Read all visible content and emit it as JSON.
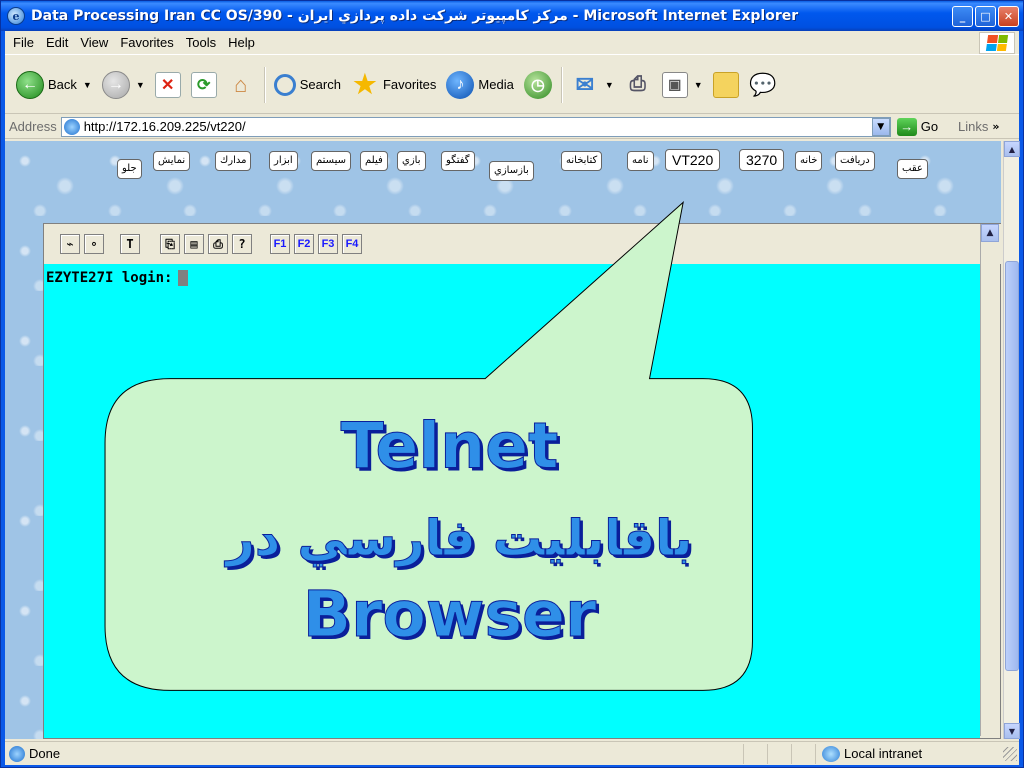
{
  "window": {
    "title": "Data Processing Iran CC OS/390 - مرکز کامپیوتر شرکت داده پردازي ايران - Microsoft Internet Explorer",
    "app_icon": "ie-icon"
  },
  "menubar": {
    "items": [
      "File",
      "Edit",
      "View",
      "Favorites",
      "Tools",
      "Help"
    ]
  },
  "toolbar": {
    "back_label": "Back",
    "search_label": "Search",
    "favorites_label": "Favorites",
    "media_label": "Media"
  },
  "address": {
    "label": "Address",
    "url": "http://172.16.209.225/vt220/",
    "go_label": "Go",
    "links_label": "Links"
  },
  "nav_buttons": {
    "back": "عقب",
    "receive": "دریافت",
    "home": "خانه",
    "b3270": "3270",
    "vt220": "VT220",
    "letter": "نامه",
    "library": "کتابخانه",
    "restore": "بازسازي",
    "chat": "گفتگو",
    "game": "بازي",
    "film": "فيلم",
    "system": "سيستم",
    "tools": "ابزار",
    "documents": "مدارك",
    "display": "نمايش",
    "forward": "جلو"
  },
  "terminal": {
    "toolbar_icons": [
      "connect-icon",
      "disconnect-icon",
      "text-cursor-icon",
      "copy-icon",
      "paste-icon",
      "print-icon",
      "help-icon"
    ],
    "function_keys": [
      "F1",
      "F2",
      "F3",
      "F4"
    ],
    "screen_text": "EZYTE27I login:",
    "screen_color": "#00ffff"
  },
  "callout": {
    "line1": "Telnet",
    "line2": "باقابليت فارسي در",
    "line3": "Browser",
    "bg_color": "#ccf5cc",
    "text_color": "#2f8fe8",
    "shadow_color": "#0a1f9a"
  },
  "statusbar": {
    "status_text": "Done",
    "zone_text": "Local intranet"
  }
}
